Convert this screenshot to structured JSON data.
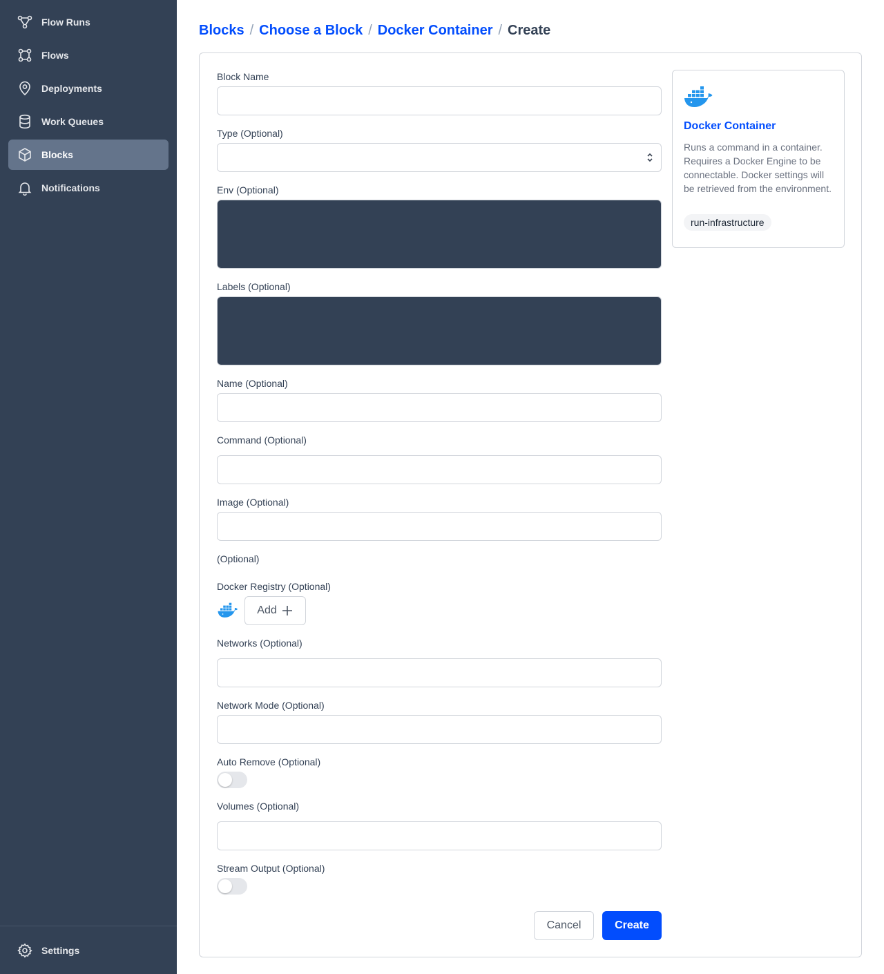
{
  "sidebar": {
    "items": [
      {
        "label": "Flow Runs",
        "icon": "flow-runs-icon"
      },
      {
        "label": "Flows",
        "icon": "flows-icon"
      },
      {
        "label": "Deployments",
        "icon": "map-pin-icon"
      },
      {
        "label": "Work Queues",
        "icon": "database-icon"
      },
      {
        "label": "Blocks",
        "icon": "cube-icon"
      },
      {
        "label": "Notifications",
        "icon": "bell-icon"
      }
    ],
    "settings_label": "Settings"
  },
  "breadcrumb": {
    "items": [
      "Blocks",
      "Choose a Block",
      "Docker Container"
    ],
    "current": "Create",
    "separator": "/"
  },
  "form": {
    "block_name_label": "Block Name",
    "type_label": "Type (Optional)",
    "env_label": "Env (Optional)",
    "labels_label": "Labels (Optional)",
    "name_label": "Name (Optional)",
    "command_label": "Command (Optional)",
    "image_label": "Image (Optional)",
    "optional_label": "(Optional)",
    "docker_registry_label": "Docker Registry (Optional)",
    "add_label": "Add",
    "networks_label": "Networks (Optional)",
    "network_mode_label": "Network Mode (Optional)",
    "auto_remove_label": "Auto Remove (Optional)",
    "volumes_label": "Volumes (Optional)",
    "stream_output_label": "Stream Output (Optional)",
    "cancel_label": "Cancel",
    "create_label": "Create"
  },
  "card": {
    "title": "Docker Container",
    "description": "Runs a command in a container. Requires a Docker Engine to be connectable. Docker settings will be retrieved from the environment.",
    "tag": "run-infrastructure"
  },
  "colors": {
    "sidebar_bg": "#334155",
    "active_item": "#64748b",
    "accent": "#024dfd",
    "docker_blue": "#2496ed",
    "code_bg": "#334155"
  }
}
